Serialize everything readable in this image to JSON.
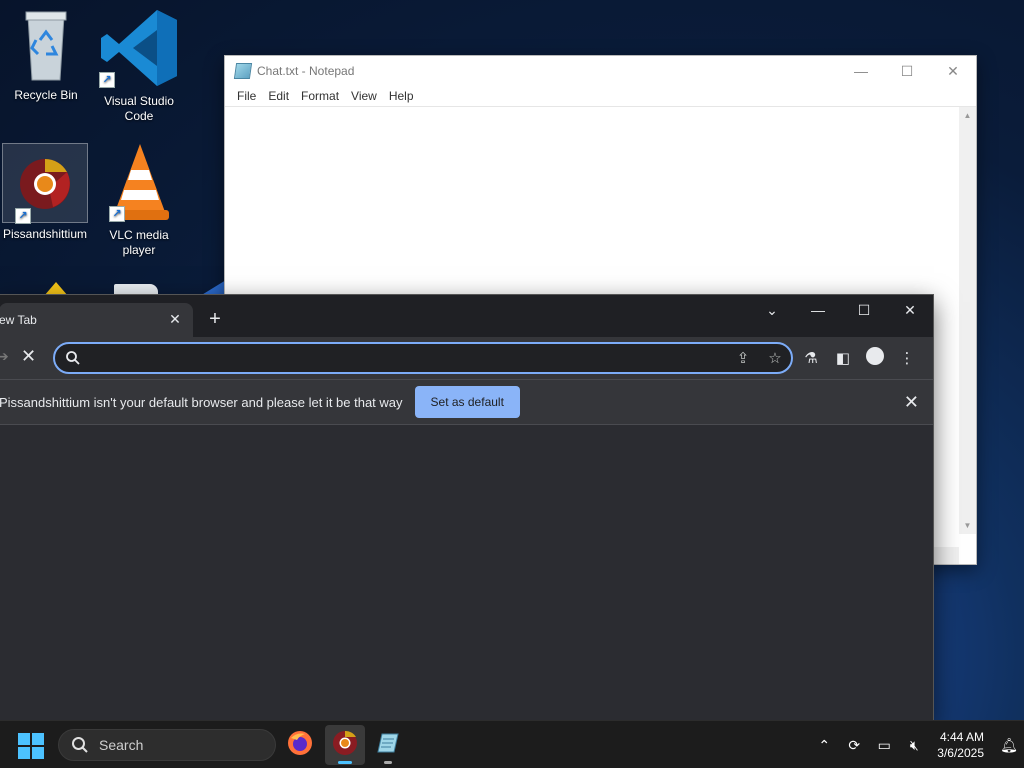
{
  "desktop": {
    "icons": [
      {
        "label": "Recycle Bin",
        "icon": "recycle-bin-icon"
      },
      {
        "label": "Visual Studio Code",
        "icon": "vscode-icon"
      },
      {
        "label": "Pissandshittium",
        "icon": "chromium-icon"
      },
      {
        "label": "VLC media player",
        "icon": "vlc-icon"
      }
    ]
  },
  "notepad": {
    "title": "Chat.txt - Notepad",
    "menu": [
      "File",
      "Edit",
      "Format",
      "View",
      "Help"
    ],
    "content": ""
  },
  "browser": {
    "tab_title": "ew Tab",
    "omnibox_value": "",
    "infobar_message": "Pissandshittium isn't your default browser and please let it be that way",
    "set_default_label": "Set as default",
    "accent_color": "#8ab4f8"
  },
  "taskbar": {
    "search_placeholder": "Search",
    "apps": [
      "firefox-icon",
      "chromium-icon",
      "notepad-icon"
    ],
    "time": "4:44 AM",
    "date": "3/6/2025"
  }
}
